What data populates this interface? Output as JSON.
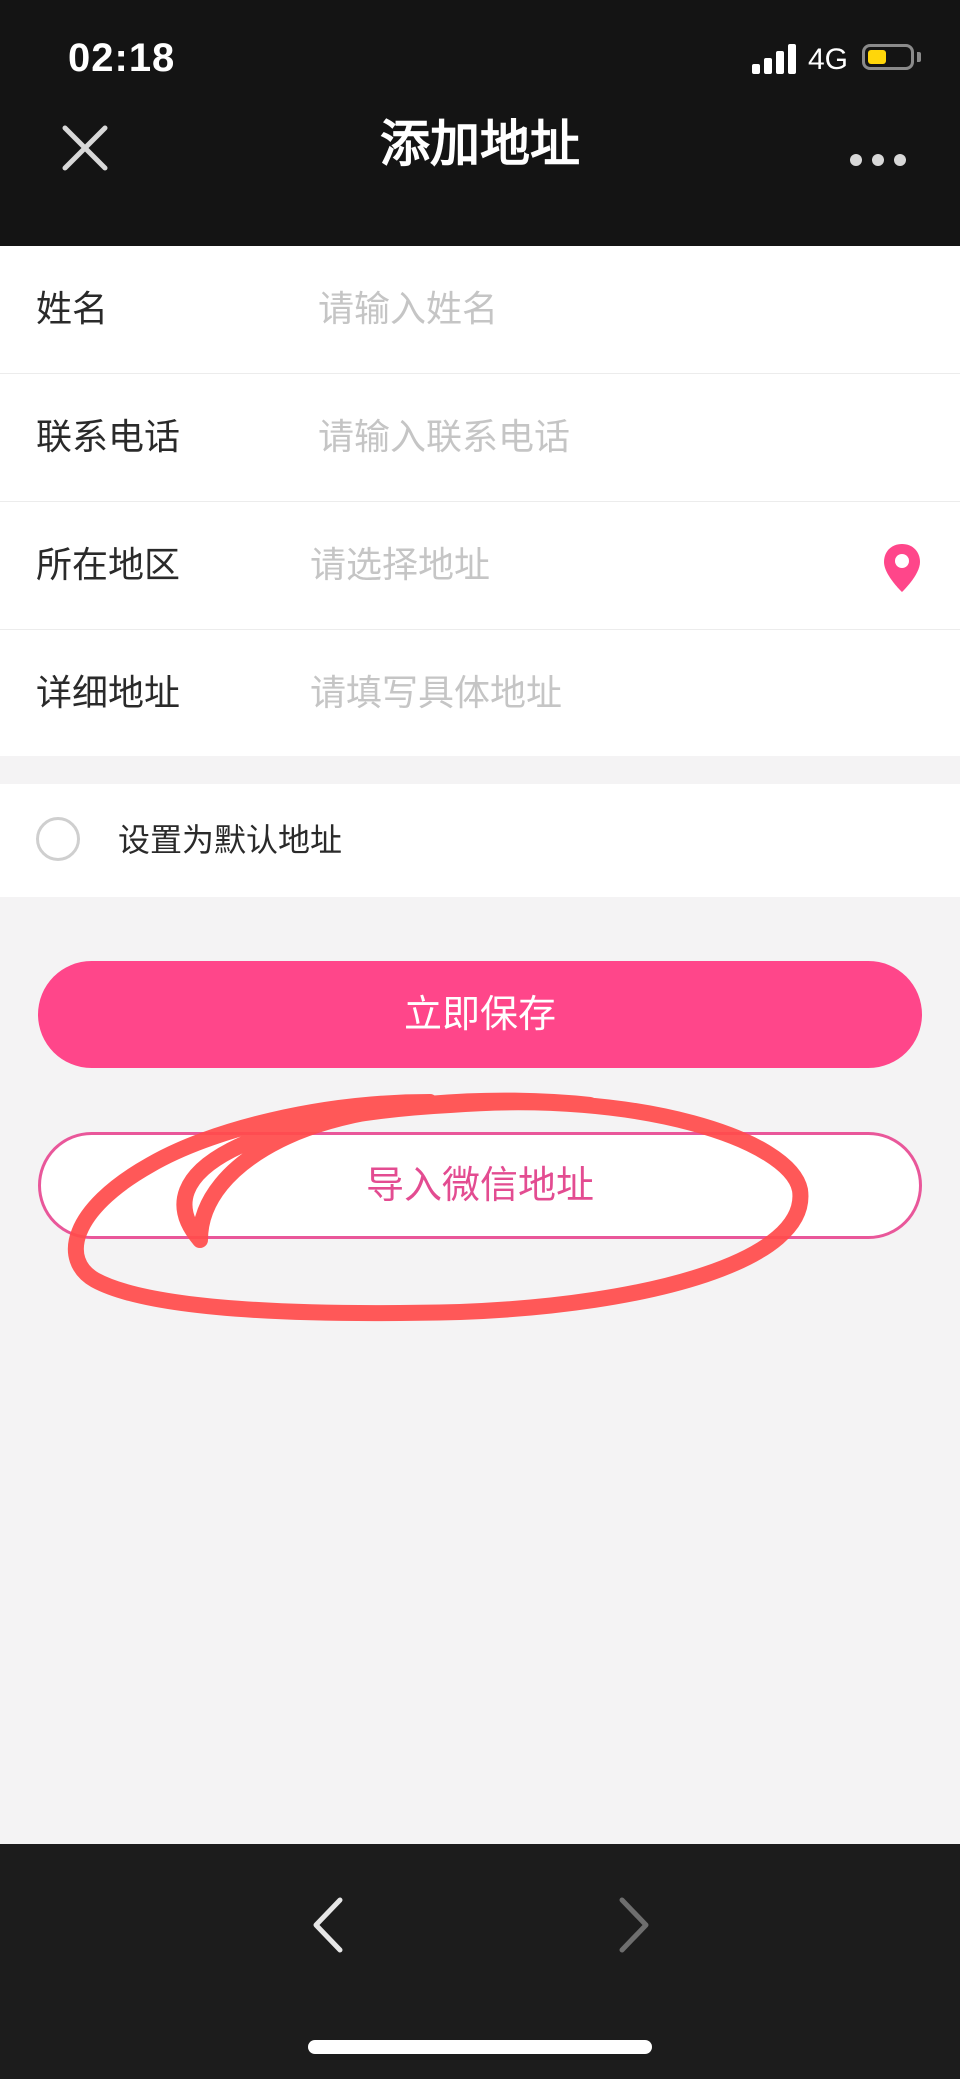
{
  "status_bar": {
    "time": "02:18",
    "network": "4G",
    "battery_level": 0.45,
    "battery_color": "#ffd60a"
  },
  "nav": {
    "close_icon": "close-icon",
    "title": "添加地址",
    "more_icon": "more-icon"
  },
  "form": {
    "fields": [
      {
        "label": "姓名",
        "placeholder": "请输入姓名",
        "value": ""
      },
      {
        "label": "联系电话",
        "placeholder": "请输入联系电话",
        "value": ""
      },
      {
        "label": "所在地区",
        "placeholder": "请选择地址",
        "value": "",
        "icon": "location-pin-icon"
      },
      {
        "label": "详细地址",
        "placeholder": "请填写具体地址",
        "value": ""
      }
    ],
    "default_address": {
      "label": "设置为默认地址",
      "checked": false
    }
  },
  "actions": {
    "save_label": "立即保存",
    "import_label": "导入微信地址"
  },
  "toolbar": {
    "back_icon": "chevron-left-icon",
    "forward_icon": "chevron-right-icon"
  },
  "colors": {
    "accent": "#ff468a",
    "import_border": "#e9579a",
    "annotation": "#ff4b4b",
    "nav_background": "#141414"
  }
}
